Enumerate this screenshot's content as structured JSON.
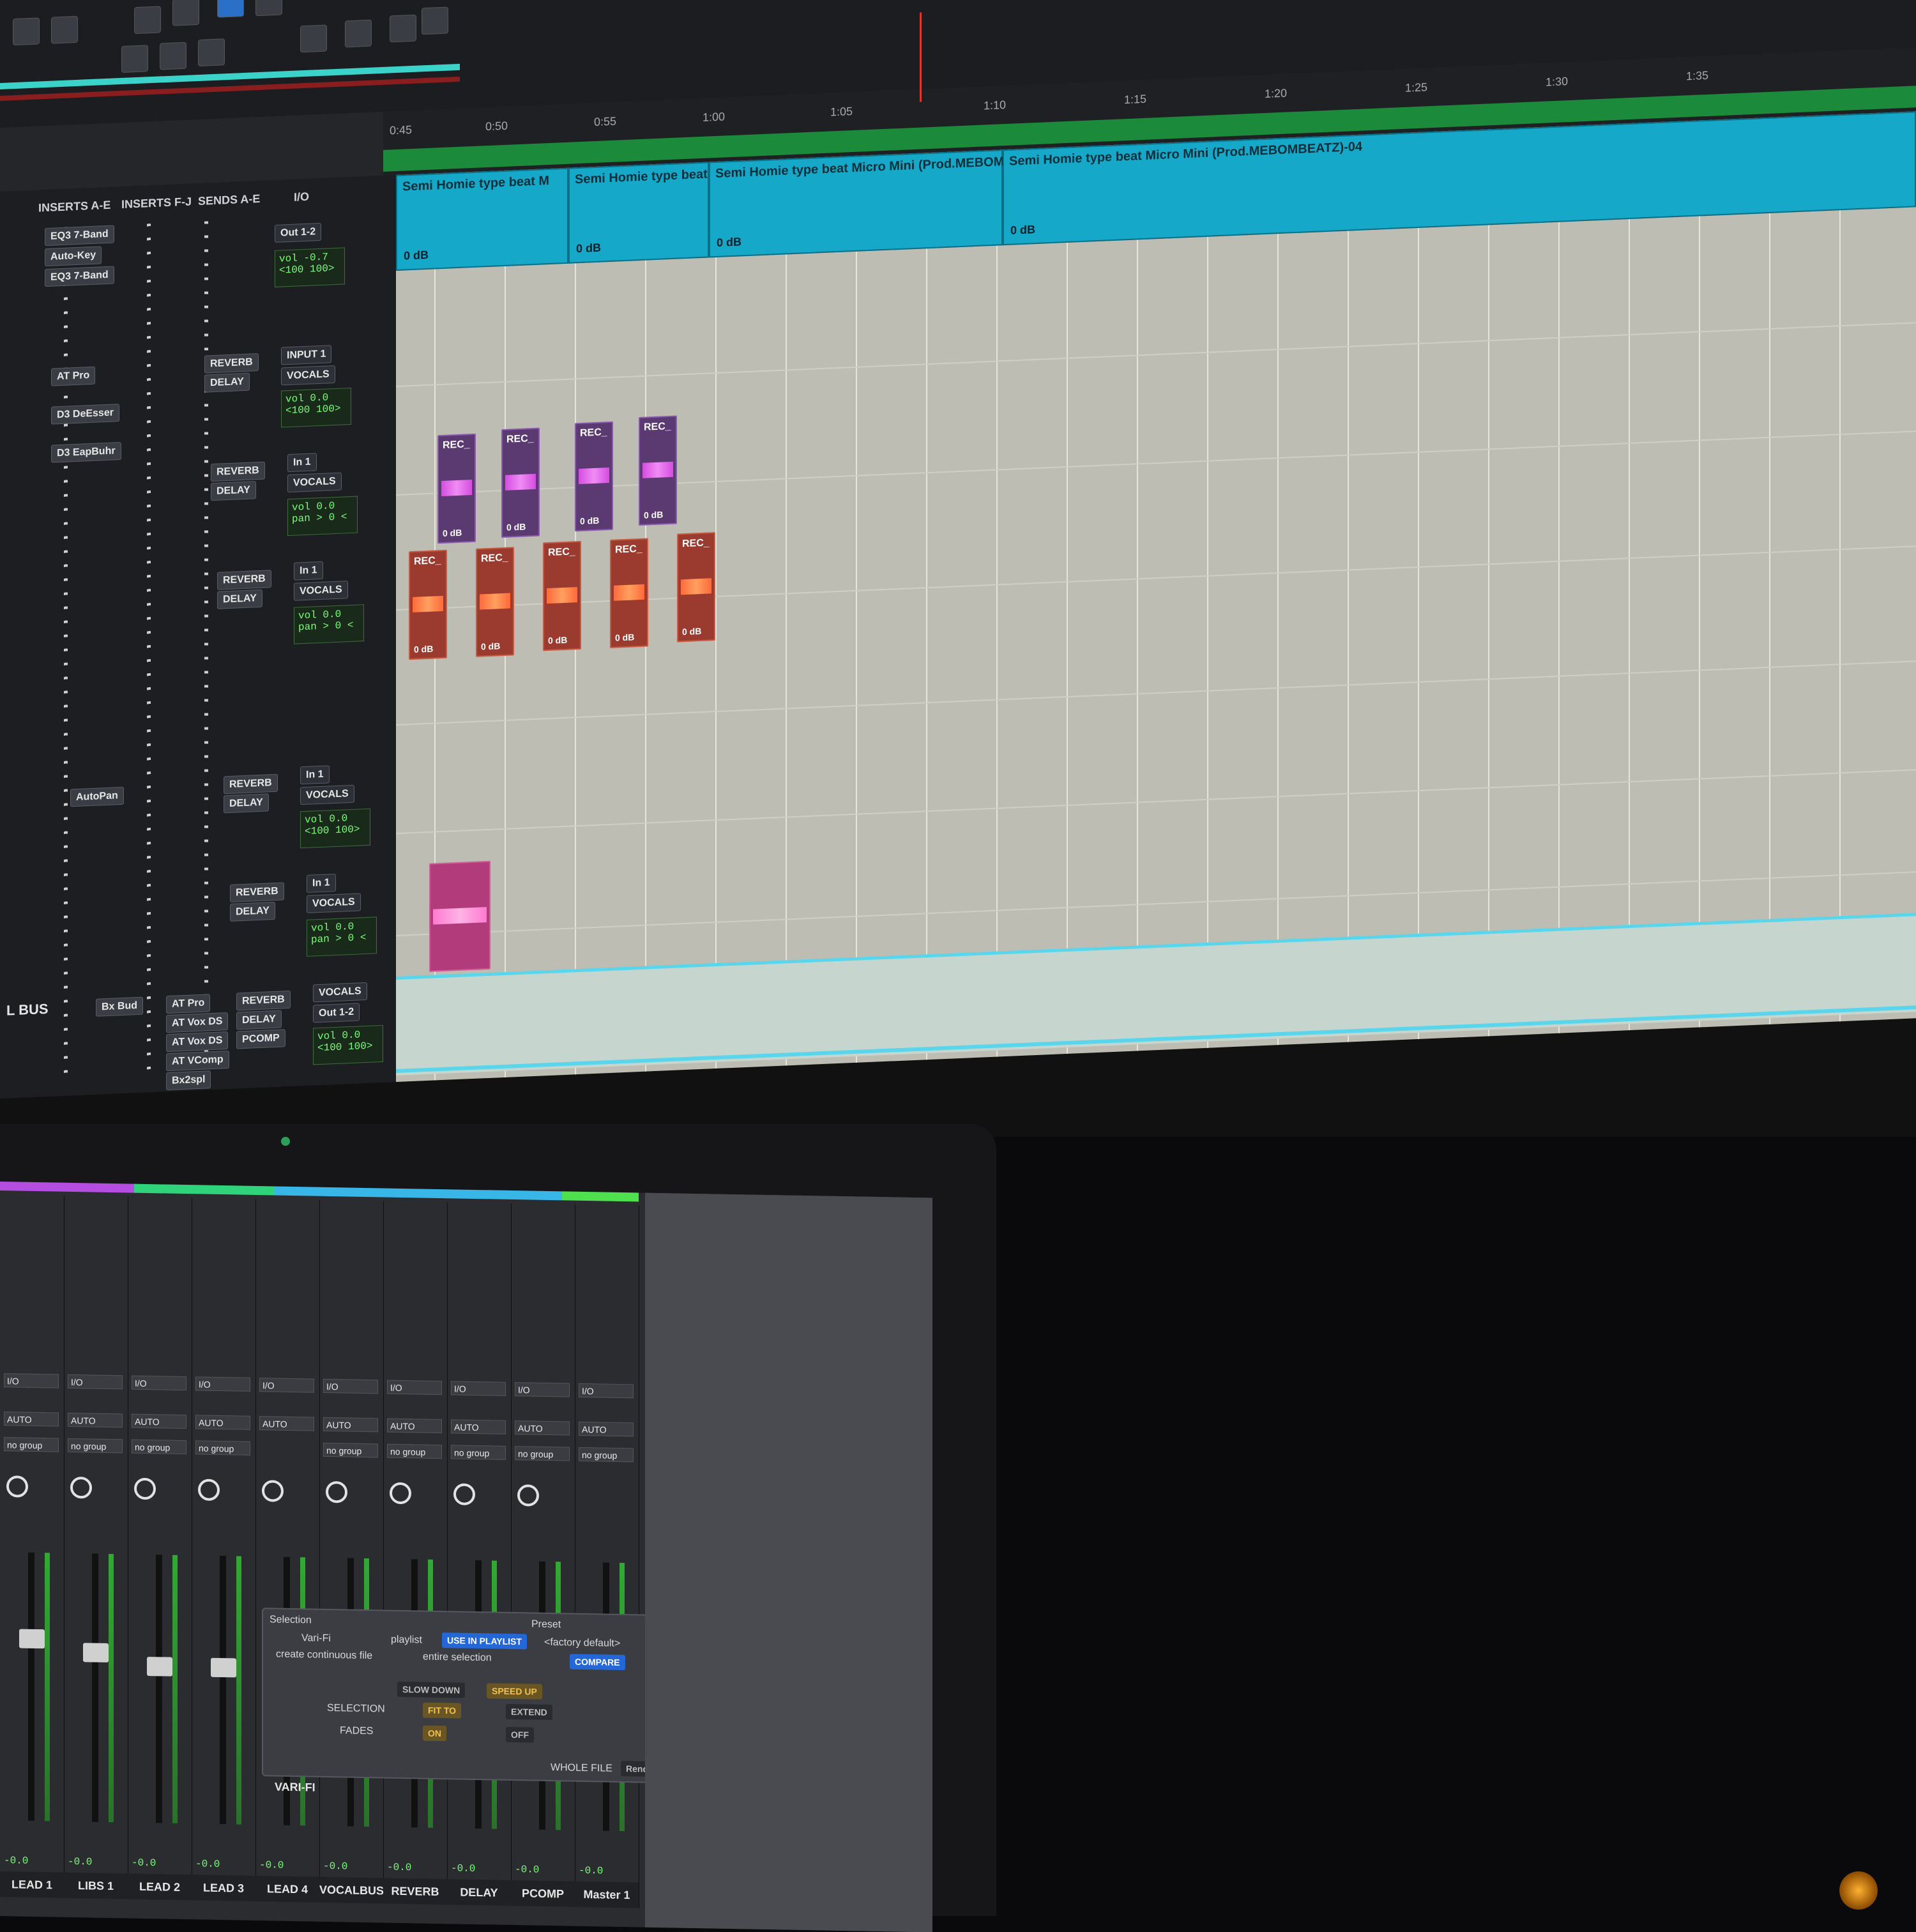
{
  "ruler": {
    "marks": [
      "0:45",
      "0:50",
      "0:55",
      "1:00",
      "1:05",
      "1:10",
      "1:15",
      "1:20",
      "1:25",
      "1:30",
      "1:35"
    ]
  },
  "top_clips": [
    {
      "name": "Semi Homie type beat M",
      "gain": "0 dB"
    },
    {
      "name": "Semi Homie type beat I",
      "gain": "0 dB"
    },
    {
      "name": "Semi Homie type beat Micro Mini (Prod.MEBOMBE",
      "gain": "0 dB"
    },
    {
      "name": "Semi Homie type beat Micro Mini (Prod.MEBOMBEATZ)-04",
      "gain": "0 dB"
    }
  ],
  "rec_label": "REC_",
  "rec_gain": "0 dB",
  "mix_headers": {
    "inserts_ae": "INSERTS A-E",
    "inserts_fj": "INSERTS F-J",
    "sends_ae": "SENDS A-E",
    "io": "I/O"
  },
  "mix_rows": [
    {
      "inserts": [
        "EQ3 7-Band",
        "Auto-Key",
        "EQ3 7-Band"
      ],
      "sends": [],
      "io": [
        "Out 1-2"
      ],
      "vol": "vol -0.7",
      "pan": "<100  100>"
    },
    {
      "inserts": [
        "AT Pro",
        "D3 DeEsser",
        "D3 EapBuhr"
      ],
      "sends": [
        "REVERB",
        "DELAY"
      ],
      "io": [
        "INPUT 1",
        "VOCALS"
      ],
      "vol": "vol 0.0",
      "pan": "<100  100>"
    },
    {
      "inserts": [],
      "sends": [
        "REVERB",
        "DELAY"
      ],
      "io": [
        "In 1",
        "VOCALS"
      ],
      "vol": "vol 0.0",
      "pan": "pan > 0 <"
    },
    {
      "inserts": [],
      "sends": [
        "REVERB",
        "DELAY"
      ],
      "io": [
        "In 1",
        "VOCALS"
      ],
      "vol": "vol 0.0",
      "pan": "pan > 0 <"
    },
    {
      "inserts": [
        "AutoPan"
      ],
      "sends": [
        "REVERB",
        "DELAY"
      ],
      "io": [
        "In 1",
        "VOCALS"
      ],
      "vol": "vol 0.0",
      "pan": "<100  100>"
    },
    {
      "inserts": [],
      "sends": [
        "REVERB",
        "DELAY"
      ],
      "io": [
        "In 1",
        "VOCALS"
      ],
      "vol": "vol 0.0",
      "pan": "pan > 0 <"
    },
    {
      "inserts": [
        "Bx Bud",
        "AT Pro",
        "AT Vox DS",
        "AT Vox DS",
        "AT VComp",
        "Bx2spl"
      ],
      "sends": [
        "REVERB",
        "DELAY",
        "PCOMP"
      ],
      "io": [
        "VOCALS",
        "Out 1-2"
      ],
      "vol": "vol 0.0",
      "pan": "<100  100>"
    }
  ],
  "bus_label": "L BUS",
  "laptop": {
    "strips": [
      {
        "name": "LEAD 1",
        "lvl": "-0.0"
      },
      {
        "name": "LIBS 1",
        "lvl": "-0.0"
      },
      {
        "name": "LEAD 2",
        "lvl": "-0.0"
      },
      {
        "name": "LEAD 3",
        "lvl": "-0.0"
      },
      {
        "name": "LEAD 4",
        "lvl": "-0.0"
      },
      {
        "name": "VOCALBUS",
        "lvl": "-0.0"
      },
      {
        "name": "REVERB",
        "lvl": "-0.0"
      },
      {
        "name": "DELAY",
        "lvl": "-0.0"
      },
      {
        "name": "PCOMP",
        "lvl": "-0.0"
      },
      {
        "name": "Master 1",
        "lvl": "-0.0"
      }
    ],
    "strip_labels": [
      "I/O",
      "AUTO",
      "no group"
    ],
    "varifi": {
      "selection": "Selection",
      "preset": "Preset",
      "vari_fi": "Vari-Fi",
      "playlist": "playlist",
      "use_in_playlist": "USE IN PLAYLIST",
      "factory_default": "<factory default>",
      "create_continuous": "create continuous file",
      "entire_selection": "entire selection",
      "compare": "COMPARE",
      "slow_down": "SLOW DOWN",
      "speed_up": "SPEED UP",
      "selection_label": "SELECTION",
      "fit_to": "FIT TO",
      "extend": "EXTEND",
      "fades": "FADES",
      "on": "ON",
      "off": "OFF",
      "whole_file": "WHOLE FILE",
      "render": "Render",
      "title": "VARI-FI"
    }
  },
  "colors": {
    "clip": "#16a8c8",
    "rec_purple": "#5b3a72",
    "rec_red": "#9b3a2e",
    "rec_pink": "#b23c7b",
    "conductor": "#1b8a3a",
    "playhead": "#e3342f"
  }
}
